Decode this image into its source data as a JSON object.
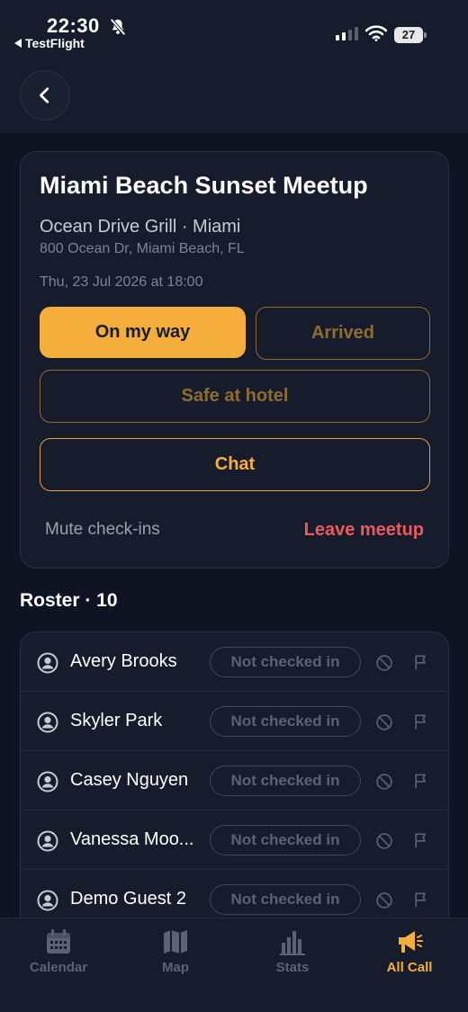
{
  "status_bar": {
    "time": "22:30",
    "back_app": "TestFlight",
    "battery": "27"
  },
  "meetup": {
    "title": "Miami Beach Sunset Meetup",
    "venue": "Ocean Drive Grill · Miami",
    "address": "800 Ocean Dr, Miami Beach, FL",
    "datetime": "Thu, 23 Jul 2026 at 18:00",
    "buttons": {
      "on_my_way": "On my way",
      "arrived": "Arrived",
      "safe_at_hotel": "Safe at hotel",
      "chat": "Chat"
    },
    "mute": "Mute check-ins",
    "leave": "Leave meetup"
  },
  "roster": {
    "title": "Roster · 10",
    "rows": [
      {
        "name": "Avery Brooks",
        "status": "Not checked in"
      },
      {
        "name": "Skyler Park",
        "status": "Not checked in"
      },
      {
        "name": "Casey Nguyen",
        "status": "Not checked in"
      },
      {
        "name": "Vanessa Moo...",
        "status": "Not checked in"
      },
      {
        "name": "Demo Guest 2",
        "status": "Not checked in"
      }
    ]
  },
  "tabs": [
    {
      "label": "Calendar",
      "icon": "calendar-icon",
      "active": false
    },
    {
      "label": "Map",
      "icon": "map-icon",
      "active": false
    },
    {
      "label": "Stats",
      "icon": "stats-icon",
      "active": false
    },
    {
      "label": "All Call",
      "icon": "megaphone-icon",
      "active": true
    }
  ],
  "colors": {
    "background": "#0f1422",
    "card": "#161c2b",
    "accent": "#f5ae3b",
    "danger": "#ec5a5f"
  }
}
